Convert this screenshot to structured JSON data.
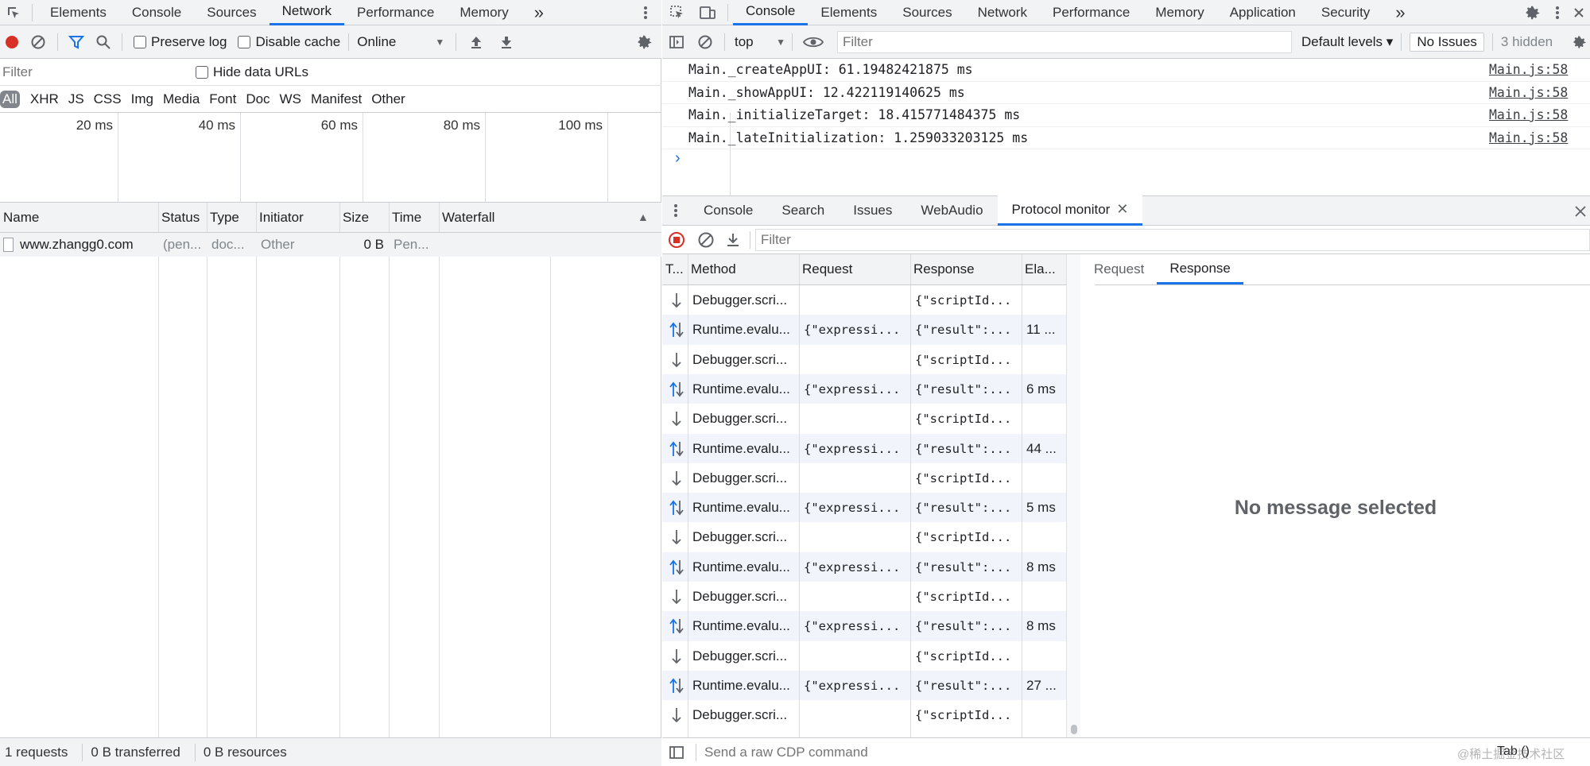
{
  "network_panel": {
    "main_tabs": [
      "Elements",
      "Console",
      "Sources",
      "Network",
      "Performance",
      "Memory"
    ],
    "active_tab": "Network",
    "more_tabs": "»",
    "toolbar": {
      "preserve_log": "Preserve log",
      "disable_cache": "Disable cache",
      "throttle": "Online"
    },
    "filter_placeholder": "Filter",
    "hide_data_urls": "Hide data URLs",
    "type_filters": [
      "All",
      "XHR",
      "JS",
      "CSS",
      "Img",
      "Media",
      "Font",
      "Doc",
      "WS",
      "Manifest",
      "Other"
    ],
    "timeline_ticks": [
      "20 ms",
      "40 ms",
      "60 ms",
      "80 ms",
      "100 ms"
    ],
    "columns": [
      "Name",
      "Status",
      "Type",
      "Initiator",
      "Size",
      "Time",
      "Waterfall"
    ],
    "rows": [
      {
        "name": "www.zhangg0.com",
        "status": "(pen...",
        "type": "doc...",
        "initiator": "Other",
        "size": "0 B",
        "time": "Pen..."
      }
    ],
    "status_bar": {
      "requests": "1 requests",
      "transferred": "0 B transferred",
      "resources": "0 B resources"
    }
  },
  "console_panel": {
    "main_tabs": [
      "Console",
      "Elements",
      "Sources",
      "Network",
      "Performance",
      "Memory",
      "Application",
      "Security"
    ],
    "active_tab": "Console",
    "more_tabs": "»",
    "context": "top",
    "filter_placeholder": "Filter",
    "levels": "Default levels ▾",
    "issues": "No Issues",
    "hidden": "3 hidden",
    "messages": [
      {
        "text": "Main._createAppUI: 61.19482421875 ms",
        "source": "Main.js:58"
      },
      {
        "text": "Main._showAppUI: 12.422119140625 ms",
        "source": "Main.js:58"
      },
      {
        "text": "Main._initializeTarget: 18.415771484375 ms",
        "source": "Main.js:58"
      },
      {
        "text": "Main._lateInitialization: 1.259033203125 ms",
        "source": "Main.js:58"
      }
    ],
    "prompt": "›"
  },
  "drawer": {
    "tabs": [
      "Console",
      "Search",
      "Issues",
      "WebAudio",
      "Protocol monitor"
    ],
    "active_tab": "Protocol monitor",
    "filter_placeholder": "Filter",
    "columns": [
      "T...",
      "Method",
      "Request",
      "Response",
      "Ela..."
    ],
    "rows": [
      {
        "dir": "down",
        "method": "Debugger.scri...",
        "request": "",
        "response": "{\"scriptId...",
        "elapsed": ""
      },
      {
        "dir": "both",
        "method": "Runtime.evalu...",
        "request": "{\"expressi...",
        "response": "{\"result\":...",
        "elapsed": "11 ..."
      },
      {
        "dir": "down",
        "method": "Debugger.scri...",
        "request": "",
        "response": "{\"scriptId...",
        "elapsed": ""
      },
      {
        "dir": "both",
        "method": "Runtime.evalu...",
        "request": "{\"expressi...",
        "response": "{\"result\":...",
        "elapsed": "6 ms"
      },
      {
        "dir": "down",
        "method": "Debugger.scri...",
        "request": "",
        "response": "{\"scriptId...",
        "elapsed": ""
      },
      {
        "dir": "both",
        "method": "Runtime.evalu...",
        "request": "{\"expressi...",
        "response": "{\"result\":...",
        "elapsed": "44 ..."
      },
      {
        "dir": "down",
        "method": "Debugger.scri...",
        "request": "",
        "response": "{\"scriptId...",
        "elapsed": ""
      },
      {
        "dir": "both",
        "method": "Runtime.evalu...",
        "request": "{\"expressi...",
        "response": "{\"result\":...",
        "elapsed": "5 ms"
      },
      {
        "dir": "down",
        "method": "Debugger.scri...",
        "request": "",
        "response": "{\"scriptId...",
        "elapsed": ""
      },
      {
        "dir": "both",
        "method": "Runtime.evalu...",
        "request": "{\"expressi...",
        "response": "{\"result\":...",
        "elapsed": "8 ms"
      },
      {
        "dir": "down",
        "method": "Debugger.scri...",
        "request": "",
        "response": "{\"scriptId...",
        "elapsed": ""
      },
      {
        "dir": "both",
        "method": "Runtime.evalu...",
        "request": "{\"expressi...",
        "response": "{\"result\":...",
        "elapsed": "8 ms"
      },
      {
        "dir": "down",
        "method": "Debugger.scri...",
        "request": "",
        "response": "{\"scriptId...",
        "elapsed": ""
      },
      {
        "dir": "both",
        "method": "Runtime.evalu...",
        "request": "{\"expressi...",
        "response": "{\"result\":...",
        "elapsed": "27 ..."
      },
      {
        "dir": "down",
        "method": "Debugger.scri...",
        "request": "",
        "response": "{\"scriptId...",
        "elapsed": ""
      }
    ],
    "detail_tabs": [
      "Request",
      "Response"
    ],
    "detail_active": "Response",
    "empty_message": "No message selected",
    "cdp_placeholder": "Send a raw CDP command",
    "target": "Tab ()",
    "watermark": "@稀土掘金技术社区"
  },
  "colors": {
    "accent": "#1a73e8",
    "record_red": "#d93025",
    "toolbar_bg": "#f1f3f4",
    "border": "#cacdd1"
  }
}
